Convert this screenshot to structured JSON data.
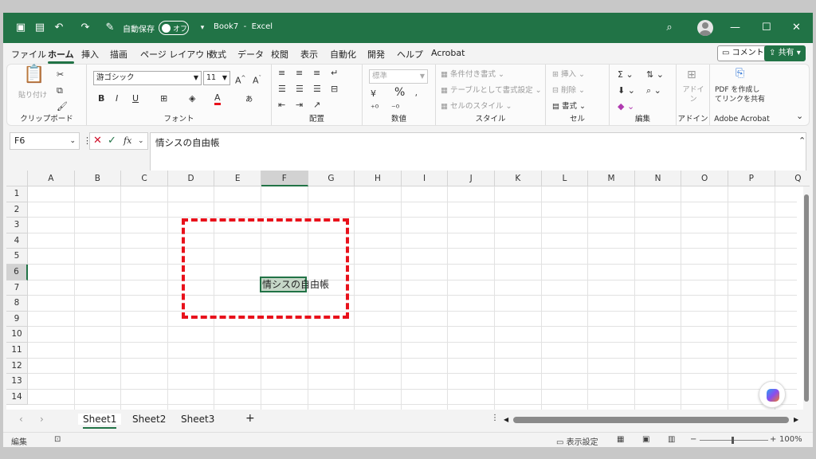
{
  "titlebar": {
    "autosave_label": "自動保存",
    "autosave_state": "オフ",
    "doc_title": "Book7",
    "separator": "-",
    "app_name": "Excel"
  },
  "menu": {
    "tabs": [
      "ファイル",
      "ホーム",
      "挿入",
      "描画",
      "ページ レイアウト",
      "数式",
      "データ",
      "校閲",
      "表示",
      "自動化",
      "開発",
      "ヘルプ",
      "Acrobat"
    ],
    "active_tab": "ホーム",
    "comment_button": "コメント",
    "share_button": "共有"
  },
  "ribbon": {
    "clipboard": {
      "paste": "貼り付け",
      "label": "クリップボード"
    },
    "font": {
      "name": "游ゴシック",
      "size": "11",
      "grow": "A^",
      "shrink": "Aˇ",
      "bold": "B",
      "italic": "I",
      "underline": "U",
      "label": "フォント"
    },
    "alignment": {
      "label": "配置"
    },
    "number": {
      "format": "標準",
      "percent": "%",
      "label": "数値"
    },
    "styles": {
      "conditional": "条件付き書式",
      "table": "テーブルとして書式設定",
      "cell_styles": "セルのスタイル",
      "label": "スタイル"
    },
    "cells": {
      "insert": "挿入",
      "delete": "削除",
      "format": "書式",
      "label": "セル"
    },
    "editing": {
      "label": "編集"
    },
    "addins": {
      "text": "アドイン",
      "label": "アドイン"
    },
    "acrobat": {
      "line1": "PDF を作成し",
      "line2": "てリンクを共有",
      "label": "Adobe Acrobat"
    }
  },
  "formula_bar": {
    "name_box": "F6",
    "fx": "fx",
    "content": "情シスの自由帳"
  },
  "grid": {
    "columns": [
      "A",
      "B",
      "C",
      "D",
      "E",
      "F",
      "G",
      "H",
      "I",
      "J",
      "K",
      "L",
      "M",
      "N",
      "O",
      "P",
      "Q"
    ],
    "rows": [
      "1",
      "2",
      "3",
      "4",
      "5",
      "6",
      "7",
      "8",
      "9",
      "10",
      "11",
      "12",
      "13",
      "14"
    ],
    "selected_column": "F",
    "selected_row": "6",
    "active_cell_text": "情シスの自由帳"
  },
  "sheets": {
    "tabs": [
      "Sheet1",
      "Sheet2",
      "Sheet3"
    ],
    "active": "Sheet1",
    "add": "+"
  },
  "statusbar": {
    "mode": "編集",
    "display_settings": "表示設定",
    "zoom": "100%"
  },
  "colors": {
    "brand": "#217346",
    "highlight_box": "#e8111b"
  }
}
